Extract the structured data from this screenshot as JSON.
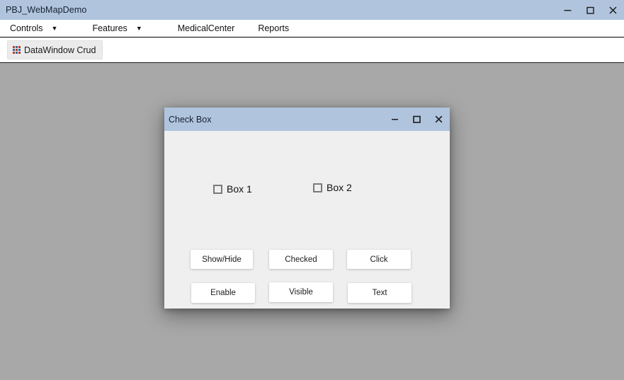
{
  "app": {
    "title": "PBJ_WebMapDemo",
    "window_controls": [
      {
        "name": "minimize",
        "glyph": "minimize-icon"
      },
      {
        "name": "maximize",
        "glyph": "maximize-icon"
      },
      {
        "name": "close",
        "glyph": "close-icon"
      }
    ],
    "menubar": [
      {
        "label": "Controls",
        "has_dropdown": true
      },
      {
        "label": "Features",
        "has_dropdown": true
      },
      {
        "label": "MedicalCenter",
        "has_dropdown": false
      },
      {
        "label": "Reports",
        "has_dropdown": false
      }
    ],
    "toolbar": [
      {
        "label": "DataWindow Crud",
        "icon": "grid-icon"
      }
    ]
  },
  "dialog": {
    "title": "Check Box",
    "window_controls": [
      {
        "name": "minimize",
        "glyph": "minimize-icon"
      },
      {
        "name": "maximize",
        "glyph": "maximize-icon"
      },
      {
        "name": "close",
        "glyph": "close-icon"
      }
    ],
    "checkboxes": [
      {
        "label": "Box 1",
        "checked": false
      },
      {
        "label": "Box 2",
        "checked": false
      }
    ],
    "buttons": [
      {
        "label": "Show/Hide"
      },
      {
        "label": "Checked"
      },
      {
        "label": "Click"
      },
      {
        "label": "Enable"
      },
      {
        "label": "Visible"
      },
      {
        "label": "Text"
      }
    ]
  },
  "colors": {
    "titlebar": "#b0c4de",
    "workspace": "#a8a8a8",
    "dialog_body": "#efefef",
    "button_face": "#ffffff",
    "toolbar_button": "#ebebeb",
    "text": "#111111"
  }
}
